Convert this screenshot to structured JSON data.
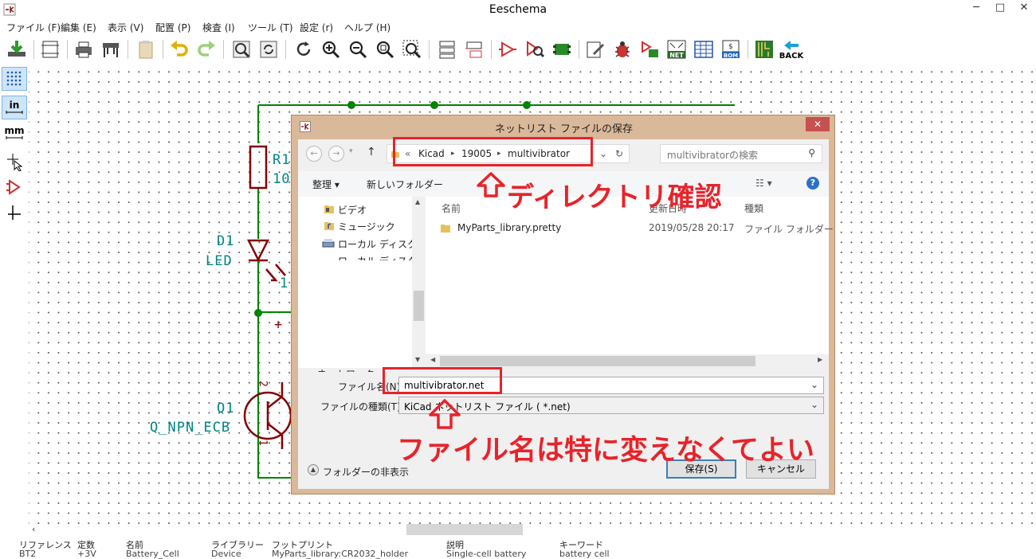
{
  "window": {
    "title": "Eeschema",
    "controls": [
      "─",
      "□",
      "✕"
    ]
  },
  "menu": [
    "ファイル (F)",
    "編集 (E)",
    "表示 (V)",
    "配置 (P)",
    "検査 (I)",
    "ツール (T)",
    "設定 (r)",
    "ヘルプ (H)"
  ],
  "toolbar": {
    "back_label": "BACK",
    "net_label": "NET",
    "bom_label": "BOM"
  },
  "left_toolbar": {
    "in_label": "in",
    "mm_label": "mm"
  },
  "schematic": {
    "r1_ref": "R1",
    "r1_val": "10",
    "d1_ref": "D1",
    "d1_val": "LED",
    "d1_pin": "1",
    "plus": "+",
    "q1_ref": "Q1",
    "q1_val": "Q_NPN_ECB",
    "q1_pin2": "2",
    "q1_pin1": "1"
  },
  "dialog": {
    "title": "ネットリスト ファイルの保存",
    "close": "✕",
    "breadcrumb": [
      "«",
      "Kicad",
      "19005",
      "multivibrator"
    ],
    "search_placeholder": "multivibratorの検索",
    "organize": "整理 ▾",
    "new_folder": "新しいフォルダー",
    "nav_items": [
      "ビデオ",
      "ミュージック",
      "ローカル ディスク (C",
      "ローカル ディスク (E",
      "ネットワーク"
    ],
    "columns": {
      "name": "名前",
      "modified": "更新日時",
      "type": "種類"
    },
    "files": [
      {
        "name": "MyParts_library.pretty",
        "modified": "2019/05/28 20:17",
        "type": "ファイル フォルダー"
      }
    ],
    "filename_label": "ファイル名(N):",
    "filename_value": "multivibrator.net",
    "filetype_label": "ファイルの種類(T):",
    "filetype_value": "KiCad ネットリスト ファイル ( *.net)",
    "hide_folders": "フォルダーの非表示",
    "save_button": "保存(S)",
    "cancel_button": "キャンセル"
  },
  "annotations": {
    "directory_check": "ディレクトリ確認",
    "filename_note": "ファイル名は特に変えなくてよい"
  },
  "status": {
    "labels": [
      "リファレンス",
      "定数",
      "名前",
      "ライブラリー",
      "フットプリント",
      "説明",
      "キーワード"
    ],
    "values": [
      "BT2",
      "+3V",
      "Battery_Cell",
      "Device",
      "MyParts_library:CR2032_holder",
      "Single-cell battery",
      "battery cell"
    ]
  },
  "colors": {
    "wire": "#008400",
    "component": "#840000",
    "text": "#008484",
    "accent": "#e8232a"
  }
}
